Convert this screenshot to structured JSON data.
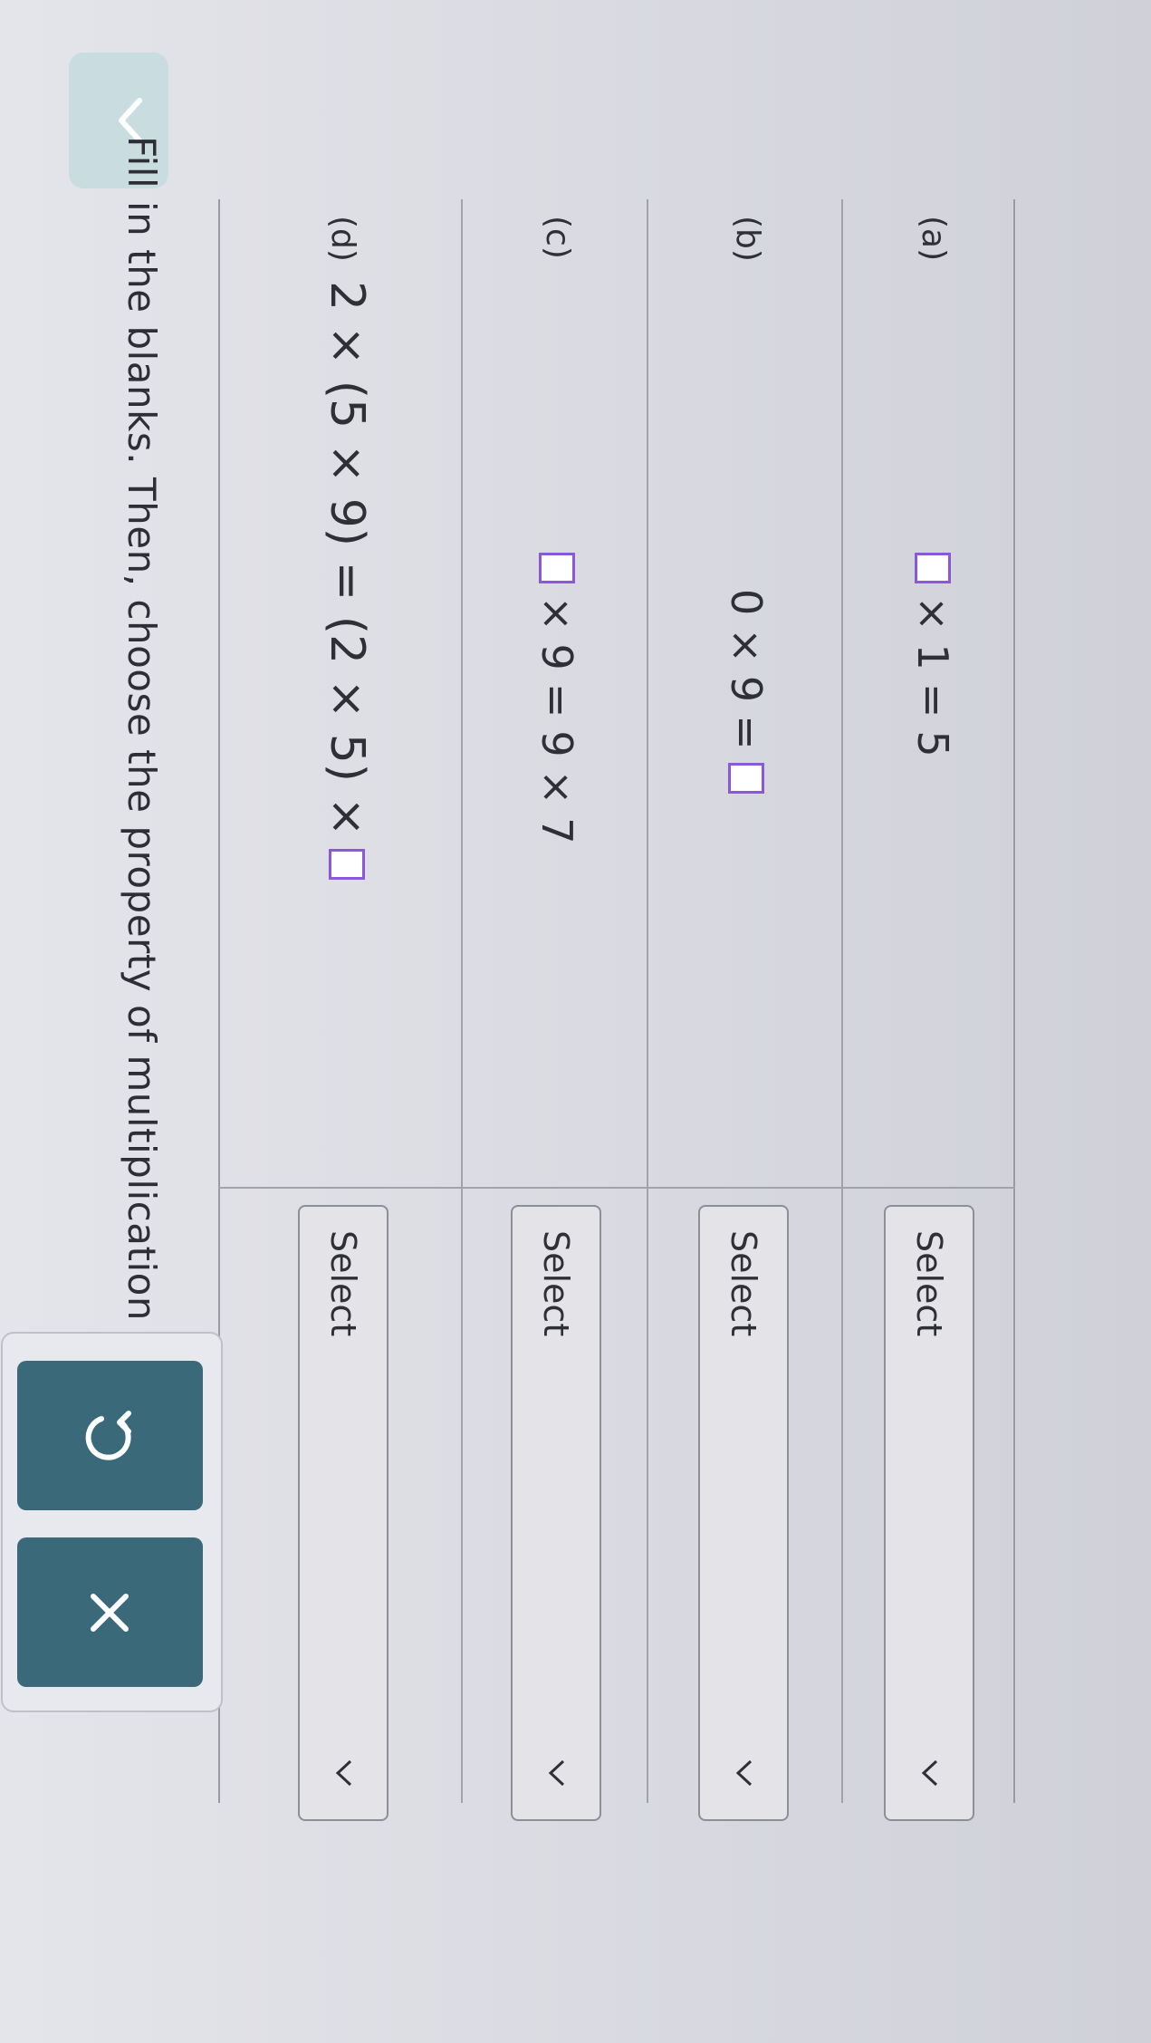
{
  "instruction": "Fill in the blanks. Then, choose the property of multiplication you used.",
  "rows": [
    {
      "label": "(a)",
      "expr_parts": [
        "×",
        "1",
        "=",
        "5"
      ],
      "select": "Select"
    },
    {
      "label": "(b)",
      "expr_parts": [
        "0",
        "×",
        "9",
        "="
      ],
      "select": "Select"
    },
    {
      "label": "(c)",
      "expr_parts": [
        "×",
        "9",
        "=",
        "9",
        "×",
        "7"
      ],
      "select": "Select"
    },
    {
      "label": "(d)",
      "expr": "2 × (5 × 9) = (2 × 5) ×",
      "select": "Select"
    }
  ],
  "icons": {
    "collapse": "chevron-down-icon",
    "select_chevron": "chevron-down-icon",
    "undo": "undo-icon",
    "clear": "close-icon"
  },
  "colors": {
    "blank_border": "#8a58d8",
    "tool_button": "#3a6a7a"
  }
}
